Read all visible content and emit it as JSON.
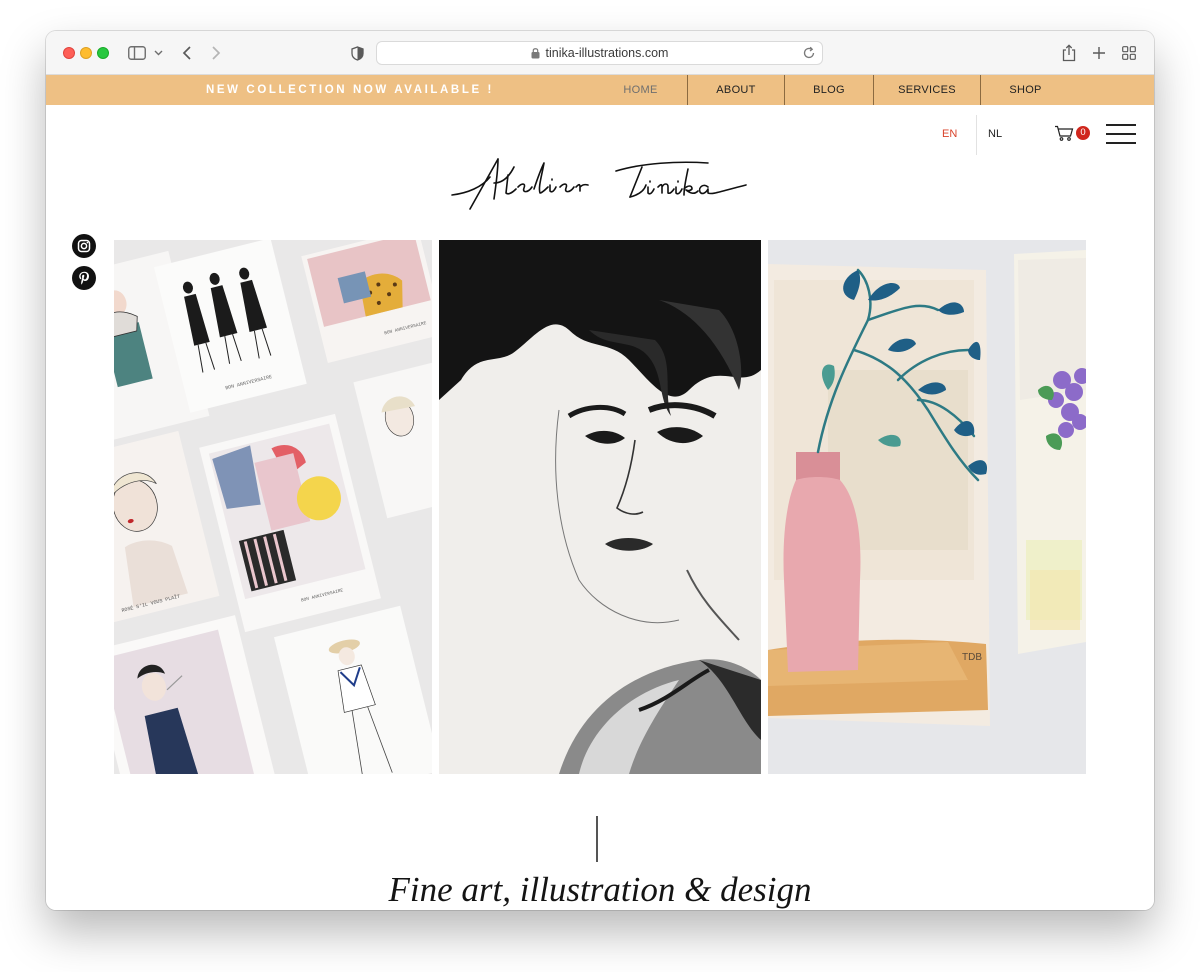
{
  "browser": {
    "url": "tinika-illustrations.com"
  },
  "icons": {
    "toolbar": [
      "sidebar-icon",
      "chevron-down-icon",
      "back-arrow-icon",
      "forward-arrow-icon",
      "shield-icon",
      "lock-icon",
      "reload-icon",
      "share-icon",
      "new-tab-icon",
      "tab-overview-icon"
    ],
    "site": [
      "cart-icon",
      "hamburger-menu-icon",
      "instagram-icon",
      "pinterest-icon"
    ]
  },
  "announcement": {
    "text": "NEW COLLECTION NOW AVAILABLE !"
  },
  "nav": {
    "items": [
      {
        "label": "HOME",
        "active": true
      },
      {
        "label": "ABOUT",
        "active": false
      },
      {
        "label": "BLOG",
        "active": false
      },
      {
        "label": "SERVICES",
        "active": false
      },
      {
        "label": "SHOP",
        "active": false
      }
    ]
  },
  "languages": {
    "en": "EN",
    "nl": "NL",
    "active": "EN"
  },
  "cart": {
    "count": "0"
  },
  "brand": {
    "logo_text": "Atelier Tinika"
  },
  "gallery": {
    "images": [
      "fashion illustration greeting cards",
      "black and white ink portrait of a woman",
      "watercolor painting of a pink vase with leaves"
    ],
    "card_captions": [
      "BON ANNIVERSAIRE",
      "ROSÉ S'IL VOUS PLAÎT"
    ],
    "painting_signature": "TDB"
  },
  "hero": {
    "tagline": "Fine art, illustration & design"
  },
  "colors": {
    "announcement_bar": "#eec084",
    "nav_separator": "#8b6a40",
    "active_language": "#d9432b",
    "cart_badge": "#d0271d",
    "text": "#222222"
  }
}
